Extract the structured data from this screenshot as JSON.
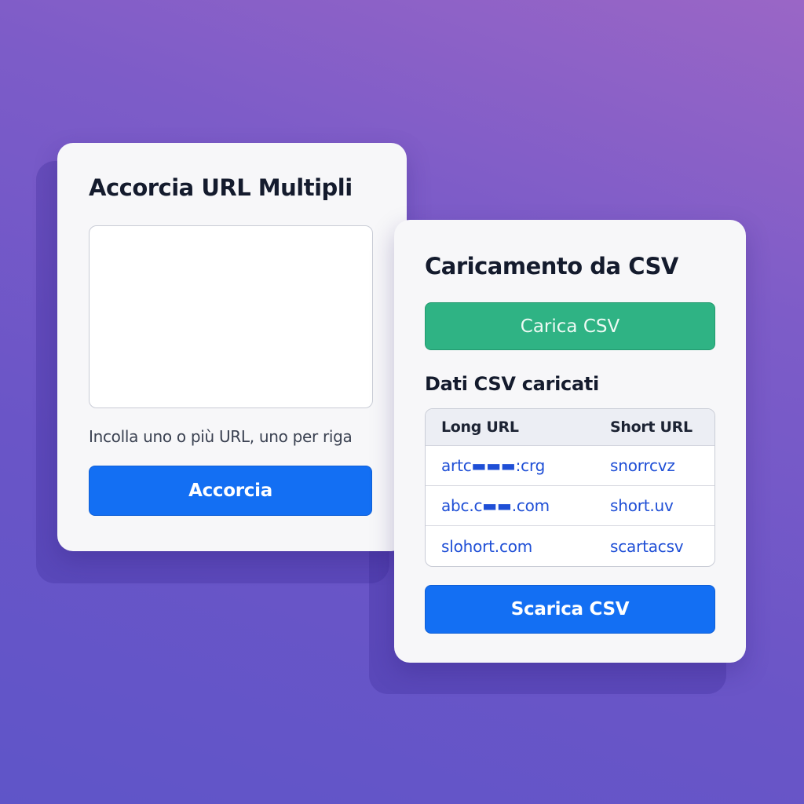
{
  "shorten_card": {
    "title": "Accorcia URL Multipli",
    "textarea_value": "",
    "hint": "Incolla uno o più URL, uno per riga",
    "button_label": "Accorcia"
  },
  "csv_card": {
    "title": "Caricamento da CSV",
    "upload_label": "Carica CSV",
    "uploaded_title": "Dati CSV caricati",
    "table": {
      "headers": [
        "Long URL",
        "Short URL"
      ],
      "rows": [
        {
          "long": "artc▬▬▬:crg",
          "short": "snorrcvz"
        },
        {
          "long": "abc.c▬▬.com",
          "short": "short.uv"
        },
        {
          "long": "slohort.com",
          "short": "scartacsv"
        }
      ]
    },
    "download_label": "Scarica CSV"
  },
  "colors": {
    "primary_button": "#136ff3",
    "upload_button": "#2fb384",
    "link": "#1f4fd6",
    "background_top": "#9a66c6",
    "background_bottom": "#5f55c8"
  }
}
